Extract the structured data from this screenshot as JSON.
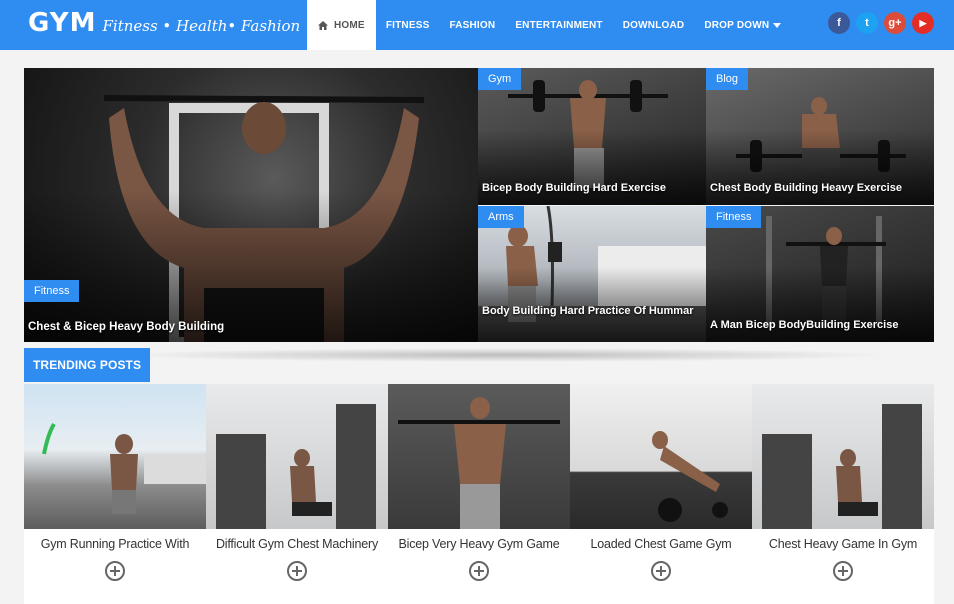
{
  "brand": {
    "logo": "GYM",
    "tagline": "Fitness • Health• Fashion"
  },
  "nav": {
    "items": [
      {
        "label": "HOME",
        "active": true
      },
      {
        "label": "FITNESS"
      },
      {
        "label": "FASHION"
      },
      {
        "label": "ENTERTAINMENT"
      },
      {
        "label": "DOWNLOAD"
      },
      {
        "label": "DROP DOWN"
      }
    ]
  },
  "social": [
    {
      "name": "facebook",
      "glyph": "f",
      "color": "#3b5998"
    },
    {
      "name": "twitter",
      "glyph": "t",
      "color": "#1da1f2"
    },
    {
      "name": "google-plus",
      "glyph": "g+",
      "color": "#dd4b39"
    },
    {
      "name": "youtube",
      "glyph": "▶",
      "color": "#e52d27"
    }
  ],
  "featured": {
    "main": {
      "category": "Fitness",
      "title": "Chest & Bicep Heavy Body Building"
    },
    "tiles": [
      {
        "category": "Gym",
        "title": "Bicep Body Building Hard Exercise"
      },
      {
        "category": "Blog",
        "title": "Chest Body Building Heavy Exercise"
      },
      {
        "category": "Arms",
        "title": "Body Building Hard Practice Of Hummar"
      },
      {
        "category": "Fitness",
        "title": "A Man Bicep BodyBuilding Exercise"
      }
    ]
  },
  "trending": {
    "heading": "TRENDING POSTS",
    "posts": [
      {
        "title": "Gym Running Practice With"
      },
      {
        "title": "Difficult Gym Chest Machinery"
      },
      {
        "title": "Bicep Very Heavy Gym Game"
      },
      {
        "title": "Loaded Chest Game Gym"
      },
      {
        "title": "Chest Heavy Game In Gym"
      }
    ]
  },
  "colors": {
    "accent": "#2f8cf0"
  }
}
